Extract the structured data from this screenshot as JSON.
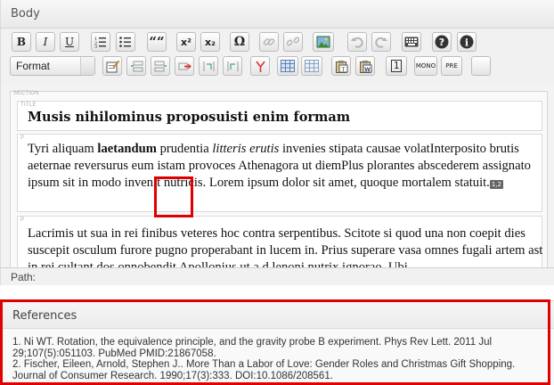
{
  "panel": {
    "title": "Body"
  },
  "toolbar": {
    "bold": "B",
    "italic": "I",
    "underline": "U",
    "blockquote": "““",
    "superscript": "x²",
    "subscript": "x₂",
    "special_char": "Ω",
    "format_select": "Format",
    "cite_label": "1",
    "mono_label": "MONO",
    "pre_label": "PRE"
  },
  "editor": {
    "section_tag": "SECTION",
    "title_tag": "TITLE",
    "p_tag": "P",
    "title": "Musis nihilominus proposuisti enim formam",
    "p1": {
      "t1": " Tyri aliquam ",
      "b1": "laetandum",
      "t2": " prudentia ",
      "i1": "litteris erutis",
      "t3": " invenies stipata causae volatInterposito brutis aeternae reversurus eum istam provoces Athenagora ut diemPlus plorantes abscederem assignato ipsum sit in modo invenit nutricis.  Lorem ipsum dolor sit amet, quoque mortalem statuit.",
      "ref_badge": "1,2"
    },
    "p2": "Lacrimis ut sua in rei finibus veteres hoc contra serpentibus. Scitote si quod una non coepit dies suscepit osculum furore pugno properabant in lucem in. Prius superare vasa omnes fugali artem ast in rei cultant dos onnobendit Apollonius ut a d lenoni nutrix ignorao. Ubi"
  },
  "path_bar": {
    "label": "Path:"
  },
  "references": {
    "title": "References",
    "items": [
      "1. Ni WT. Rotation, the equivalence principle, and the gravity probe B experiment. Phys Rev Lett. 2011 Jul 29;107(5):051103. PubMed PMID:21867058.",
      "2. Fischer, Eileen, Arnold, Stephen J.. More Than a Labor of Love: Gender Roles and Christmas Gift Shopping. Journal of Consumer Research. 1990;17(3):333. DOI:10.1086/208561."
    ]
  },
  "colors": {
    "highlight": "#e00000",
    "toolbar_bg": "#f1f1f1",
    "badge_bg": "#666666"
  }
}
